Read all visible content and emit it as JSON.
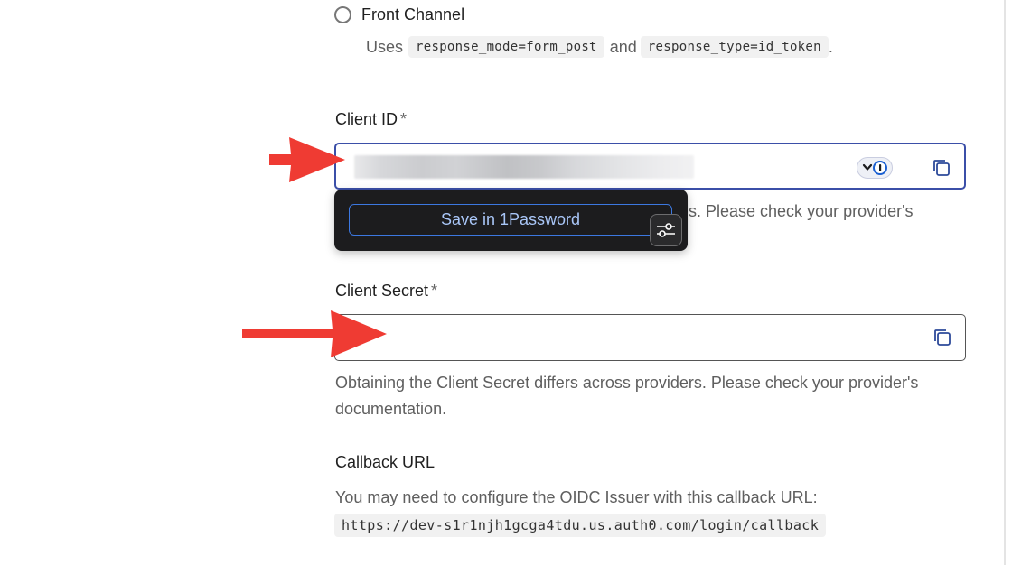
{
  "front_channel": {
    "label": "Front Channel",
    "desc_prefix": "Uses",
    "code1": "response_mode=form_post",
    "desc_and": "and",
    "code2": "response_type=id_token",
    "desc_suffix": "."
  },
  "client_id": {
    "label": "Client ID",
    "required": "*",
    "help_visible_fragment": "s. Please check your provider's"
  },
  "password_manager_popup": {
    "save_label": "Save in 1Password"
  },
  "client_secret": {
    "label": "Client Secret",
    "required": "*",
    "help": "Obtaining the Client Secret differs across providers. Please check your provider's documentation."
  },
  "callback": {
    "title": "Callback URL",
    "description": "You may need to configure the OIDC Issuer with this callback URL:",
    "url": "https://dev-s1r1njh1gcga4tdu.us.auth0.com/login/callback"
  },
  "colors": {
    "focus_border": "#3b4fa8",
    "annotation_arrow": "#ef3b33",
    "popup_bg": "#1c1c1e",
    "popup_button_border": "#3c78e0"
  }
}
